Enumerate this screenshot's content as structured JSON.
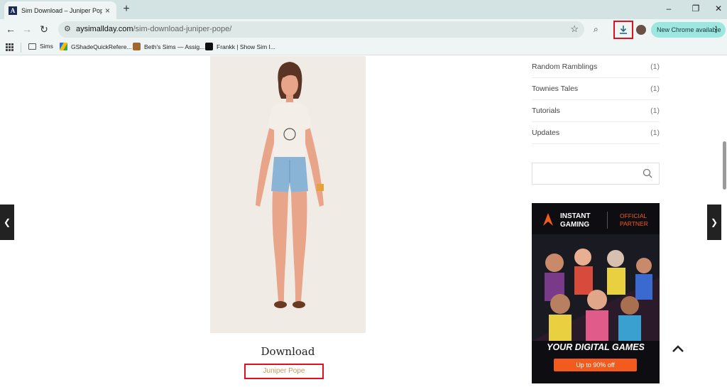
{
  "browser": {
    "tab_title": "Sim Download – Juniper Pope",
    "favicon_letter": "A",
    "url_host": "aysimallday.com",
    "url_path": "/sim-download-juniper-pope/",
    "update_label": "New Chrome available",
    "bookmarks": [
      {
        "label": "Sims",
        "icon": "folder-icon"
      },
      {
        "label": "GShadeQuickRefere...",
        "icon": "drive-icon"
      },
      {
        "label": "Beth's Sims — Assig...",
        "icon": "bookmark-favicon"
      },
      {
        "label": "Frankk | Show Sim I...",
        "icon": "bookmark-favicon"
      }
    ]
  },
  "sidebar": {
    "categories": [
      {
        "label": "Random Ramblings",
        "count": "(1)"
      },
      {
        "label": "Townies Tales",
        "count": "(1)"
      },
      {
        "label": "Tutorials",
        "count": "(1)"
      },
      {
        "label": "Updates",
        "count": "(1)"
      }
    ]
  },
  "ad": {
    "brand_line1": "INSTANT",
    "brand_line2": "GAMING",
    "partner_line1": "OFFICIAL",
    "partner_line2": "PARTNER",
    "headline": "YOUR DIGITAL GAMES",
    "cta": "Up to 90% off"
  },
  "main": {
    "download_heading": "Download",
    "download_link": "Juniper Pope"
  },
  "colors": {
    "highlight_box": "#e0101e",
    "link": "#c89a5a",
    "accent_orange": "#f25a1e"
  }
}
